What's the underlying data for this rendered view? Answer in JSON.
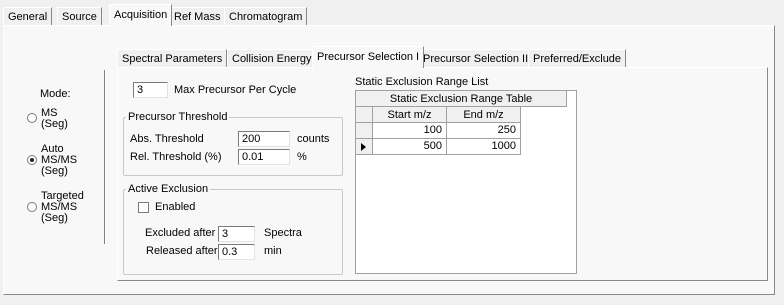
{
  "outer_tabs": [
    "General",
    "Source",
    "Acquisition",
    "Ref Mass",
    "Chromatogram"
  ],
  "outer_active": "Acquisition",
  "mode": {
    "label": "Mode:",
    "options": [
      {
        "label": "MS\n(Seg)",
        "checked": false
      },
      {
        "label": "Auto\nMS/MS\n(Seg)",
        "checked": true
      },
      {
        "label": "Targeted\nMS/MS\n(Seg)",
        "checked": false
      }
    ]
  },
  "inner_tabs": [
    "Spectral Parameters",
    "Collision Energy",
    "Precursor Selection I",
    "Precursor Selection II",
    "Preferred/Exclude"
  ],
  "inner_active": "Precursor Selection I",
  "max_precursor": {
    "value": "3",
    "label": "Max Precursor Per Cycle"
  },
  "precursor_threshold": {
    "title": "Precursor Threshold",
    "abs_label": "Abs. Threshold",
    "abs_value": "200",
    "abs_unit": "counts",
    "rel_label": "Rel. Threshold (%)",
    "rel_value": "0.01",
    "rel_unit": "%"
  },
  "active_exclusion": {
    "title": "Active Exclusion",
    "enabled_label": "Enabled",
    "enabled": false,
    "excluded_label": "Excluded after",
    "excluded_value": "3",
    "excluded_unit": "Spectra",
    "released_label": "Released after",
    "released_value": "0.3",
    "released_unit": "min"
  },
  "static_exclusion": {
    "list_label": "Static Exclusion Range List",
    "table_caption": "Static Exclusion Range Table",
    "columns": [
      "Start m/z",
      "End m/z"
    ],
    "rows": [
      {
        "start": "100",
        "end": "250",
        "current": false
      },
      {
        "start": "500",
        "end": "1000",
        "current": true
      }
    ]
  }
}
